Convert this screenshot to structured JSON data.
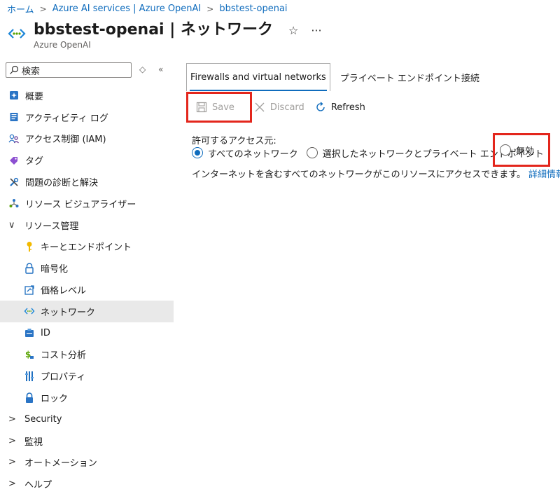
{
  "breadcrumb": {
    "home": "ホーム",
    "service": "Azure AI services | Azure OpenAI",
    "resource": "bbstest-openai"
  },
  "header": {
    "title": "bbstest-openai | ネットワーク",
    "subtitle": "Azure OpenAI"
  },
  "sidebar": {
    "search_placeholder": "検索",
    "items": [
      {
        "label": "概要",
        "icon": "overview-icon"
      },
      {
        "label": "アクティビティ ログ",
        "icon": "activity-log-icon"
      },
      {
        "label": "アクセス制御 (IAM)",
        "icon": "iam-icon"
      },
      {
        "label": "タグ",
        "icon": "tag-icon"
      },
      {
        "label": "問題の診断と解決",
        "icon": "diagnose-icon"
      },
      {
        "label": "リソース ビジュアライザー",
        "icon": "visualizer-icon"
      },
      {
        "label": "リソース管理",
        "expanded": true
      },
      {
        "label": "キーとエンドポイント",
        "icon": "key-icon"
      },
      {
        "label": "暗号化",
        "icon": "lock-icon"
      },
      {
        "label": "価格レベル",
        "icon": "pricing-icon"
      },
      {
        "label": "ネットワーク",
        "icon": "network-icon",
        "selected": true
      },
      {
        "label": "ID",
        "icon": "identity-icon"
      },
      {
        "label": "コスト分析",
        "icon": "cost-icon"
      },
      {
        "label": "プロパティ",
        "icon": "properties-icon"
      },
      {
        "label": "ロック",
        "icon": "lock-icon"
      },
      {
        "label": "Security"
      },
      {
        "label": "監視"
      },
      {
        "label": "オートメーション"
      },
      {
        "label": "ヘルプ"
      }
    ]
  },
  "tabs": {
    "active": "Firewalls and virtual networks",
    "private": "プライベート エンドポイント接続"
  },
  "toolbar": {
    "save": "Save",
    "discard": "Discard",
    "refresh": "Refresh"
  },
  "access": {
    "label": "許可するアクセス元:",
    "options": [
      "すべてのネットワーク",
      "選択したネットワークとプライベート エンドポイント",
      "無効"
    ],
    "selected": "すべてのネットワーク"
  },
  "info": {
    "text": "インターネットを含むすべてのネットワークがこのリソースにアクセスできます。",
    "link": "詳細情報"
  },
  "colors": {
    "accent": "#0f6cbd",
    "highlight": "#e3261c",
    "selected_bg": "#e9e9e9"
  }
}
